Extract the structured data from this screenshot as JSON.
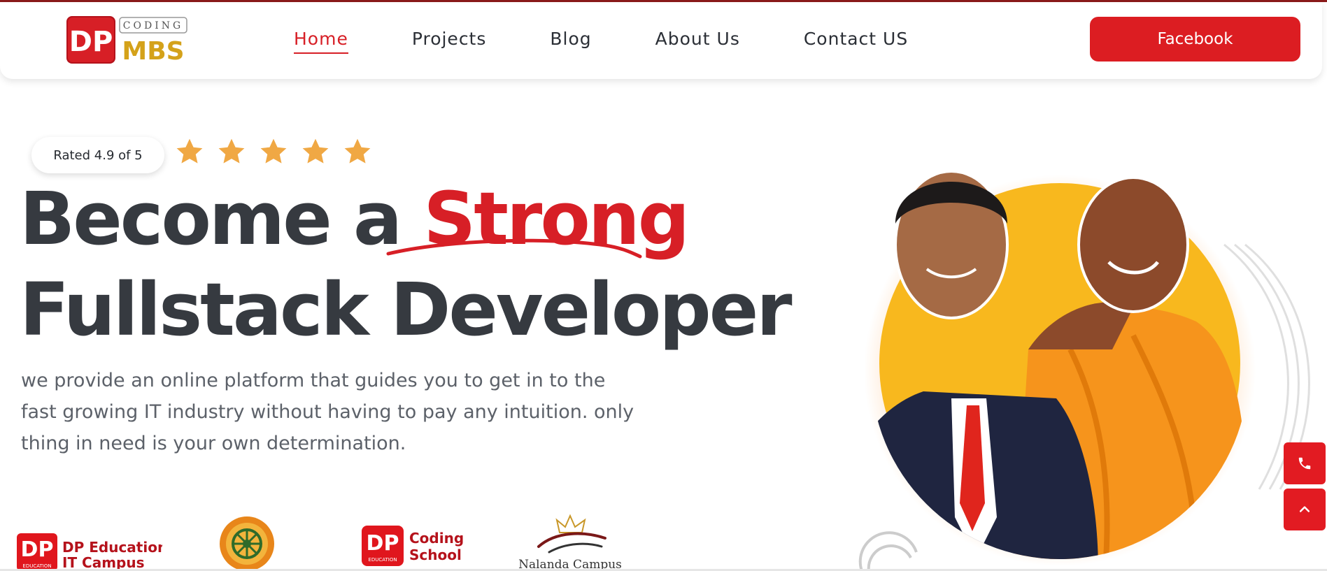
{
  "brand": {
    "logo_dp": "DP",
    "logo_coding": "CODING",
    "logo_mbs": "MBS",
    "colors": {
      "accent": "#d71f26",
      "gold": "#d4a21a",
      "dark": "#363a40"
    }
  },
  "nav": {
    "items": [
      {
        "label": "Home",
        "active": true
      },
      {
        "label": "Projects",
        "active": false
      },
      {
        "label": "Blog",
        "active": false
      },
      {
        "label": "About Us",
        "active": false
      },
      {
        "label": "Contact US",
        "active": false
      }
    ],
    "cta_label": "Facebook"
  },
  "hero": {
    "rating_text": "Rated 4.9 of 5",
    "stars_shown": 5,
    "headline_part1": "Become a ",
    "headline_accent": "Strong",
    "headline_line2": "Fullstack Developer",
    "description": "we provide an online platform that guides you to get in to the fast growing IT industry without having to pay any intuition. only thing in need is your own determination."
  },
  "partners": {
    "dp_campus_logo": "DP",
    "dp_campus_logo_sub": "EDUCATION",
    "dp_campus_line1": "DP Education",
    "dp_campus_line2": "IT Campus",
    "coding_school_logo": "DP",
    "coding_school_logo_sub": "EDUCATION",
    "coding_school_line1": "Coding",
    "coding_school_line2": "School",
    "nalanda_name": "Nalanda Campus"
  },
  "side_actions": {
    "call_icon": "phone-icon",
    "top_icon": "chevron-up-icon"
  }
}
